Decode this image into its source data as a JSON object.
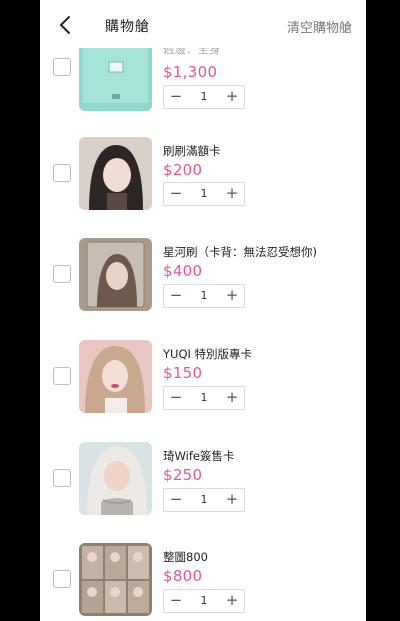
{
  "header": {
    "title": "購物艙",
    "clear_label": "清空購物艙"
  },
  "items": [
    {
      "name": "週邊：全身",
      "price": "$1,300",
      "qty": "1"
    },
    {
      "name": "刷刷滿額卡",
      "price": "$200",
      "qty": "1"
    },
    {
      "name": "星河刷（卡背：無法忍受想你)",
      "price": "$400",
      "qty": "1"
    },
    {
      "name": "YUQI 特別版專卡",
      "price": "$150",
      "qty": "1"
    },
    {
      "name": "琦Wife簽售卡",
      "price": "$250",
      "qty": "1"
    },
    {
      "name": "整圖800",
      "price": "$800",
      "qty": "1"
    }
  ],
  "colors": {
    "price": "#e4579d",
    "thumb_0": "#8fd8cc",
    "thumb_1": "#5a4a45",
    "thumb_2": "#a99a8c",
    "thumb_3": "#e9c6c2",
    "thumb_4": "#b9b3b0",
    "thumb_5": "#8f7f70"
  }
}
